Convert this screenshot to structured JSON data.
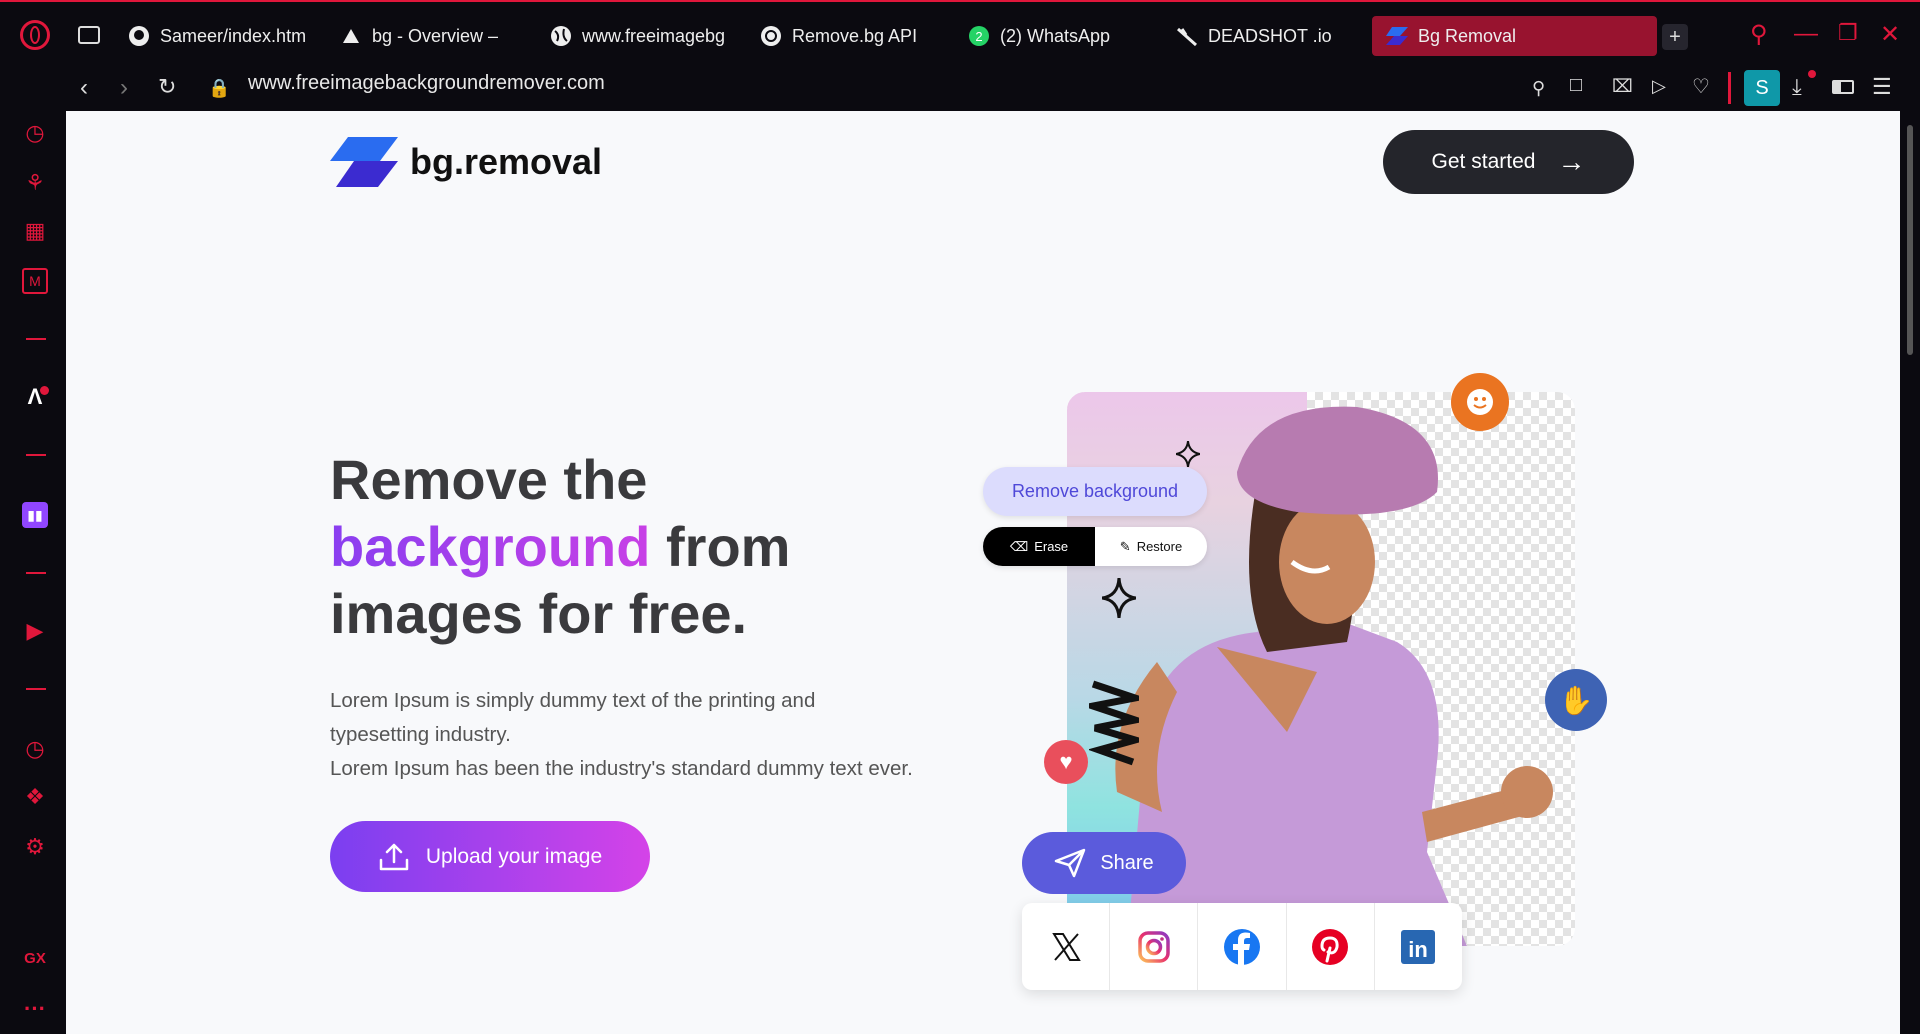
{
  "browser": {
    "tabs": [
      {
        "label": "Sameer/index.htm",
        "icon": "github-icon"
      },
      {
        "label": "bg - Overview –",
        "icon": "vercel-icon"
      },
      {
        "label": "www.freeimagebg",
        "icon": "globe-icon"
      },
      {
        "label": "Remove.bg API",
        "icon": "openai-icon"
      },
      {
        "label": "(2) WhatsApp",
        "icon": "whatsapp-icon",
        "badge": "2"
      },
      {
        "label": "DEADSHOT .io",
        "icon": "deadshot-icon"
      },
      {
        "label": "Bg Removal",
        "icon": "bg-removal-icon",
        "active": true
      }
    ],
    "url": "www.freeimagebackgroundremover.com",
    "profile_initial": "S",
    "sidebar_gx_label": "GX",
    "sidebar_more": "···",
    "accent": "#e0173b"
  },
  "page": {
    "logo_text": "bg.removal",
    "get_started": "Get started",
    "headline_1": "Remove the",
    "headline_highlight": "background",
    "headline_2": " from",
    "headline_3": "images for free.",
    "para_1": "Lorem Ipsum is simply dummy text of the printing and typesetting industry.",
    "para_2": "Lorem Ipsum has been the industry's standard dummy text ever.",
    "upload_label": "Upload your image",
    "hero": {
      "remove_bg_label": "Remove background",
      "erase_label": "Erase",
      "restore_label": "Restore",
      "share_label": "Share",
      "social": [
        "X",
        "Instagram",
        "Facebook",
        "Pinterest",
        "LinkedIn"
      ]
    }
  }
}
